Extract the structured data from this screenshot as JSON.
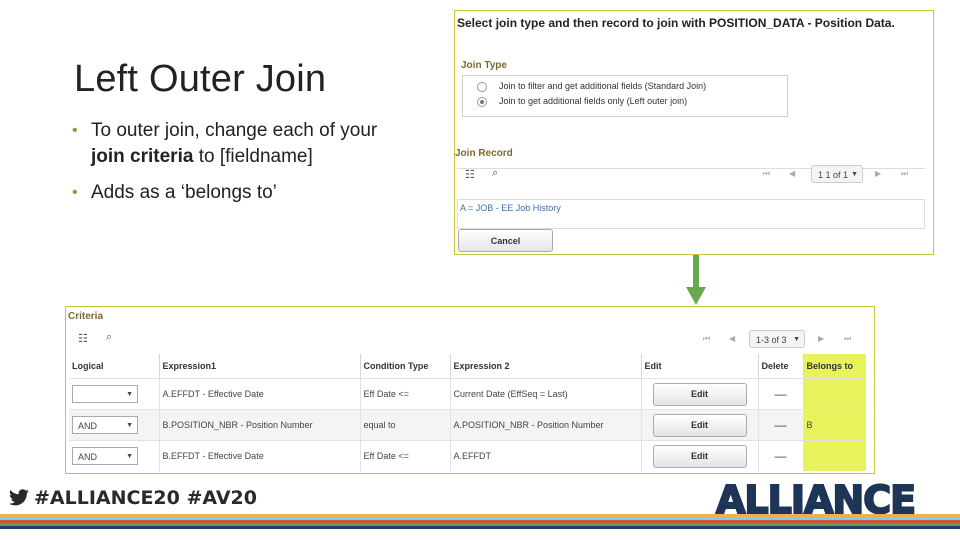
{
  "slide": {
    "title": "Left Outer Join",
    "bullets": [
      {
        "pre": "To outer join, change each of your ",
        "bold": "join criteria",
        "post": " to [fieldname]"
      },
      {
        "pre": "Adds as a ‘belongs to’",
        "bold": "",
        "post": ""
      }
    ]
  },
  "join_dialog": {
    "heading": "Select join type and then record to join with POSITION_DATA - Position Data.",
    "join_type_label": "Join Type",
    "options": [
      {
        "label": "Join to filter and get additional fields (Standard Join)",
        "checked": false
      },
      {
        "label": "Join to get additional fields only (Left outer join)",
        "checked": true
      }
    ],
    "join_record_label": "Join Record",
    "pager_text": "1 1 of 1",
    "record_link": "A = JOB - EE Job History",
    "cancel_label": "Cancel"
  },
  "criteria": {
    "label": "Criteria",
    "pager_text": "1-3 of 3",
    "columns": [
      "Logical",
      "Expression1",
      "Condition Type",
      "Expression 2",
      "Edit",
      "Delete",
      "Belongs to"
    ],
    "rows": [
      {
        "logical": "",
        "expr1": "A.EFFDT - Effective Date",
        "condition": "Eff Date <=",
        "expr2": "Current Date (EffSeq = Last)",
        "edit": "Edit",
        "delete": "—",
        "belongs": ""
      },
      {
        "logical": "AND",
        "expr1": "B.POSITION_NBR - Position Number",
        "condition": "equal to",
        "expr2": "A.POSITION_NBR - Position Number",
        "edit": "Edit",
        "delete": "—",
        "belongs": "B"
      },
      {
        "logical": "AND",
        "expr1": "B.EFFDT - Effective Date",
        "condition": "Eff Date <=",
        "expr2": "A.EFFDT",
        "edit": "Edit",
        "delete": "—",
        "belongs": ""
      }
    ]
  },
  "footer": {
    "hashtags": "#ALLIANCE20 #AV20",
    "logo": "ALLIANCE",
    "stripe_colors": [
      "#e8b34a",
      "#8cc5e8",
      "#c85a3a",
      "#6a9a4a",
      "#2a3a6a"
    ]
  },
  "colors": {
    "accent": "#c9c63c",
    "belongs_highlight": "#e8f25c",
    "arrow": "#6aa84f",
    "link": "#3f6fa4"
  }
}
